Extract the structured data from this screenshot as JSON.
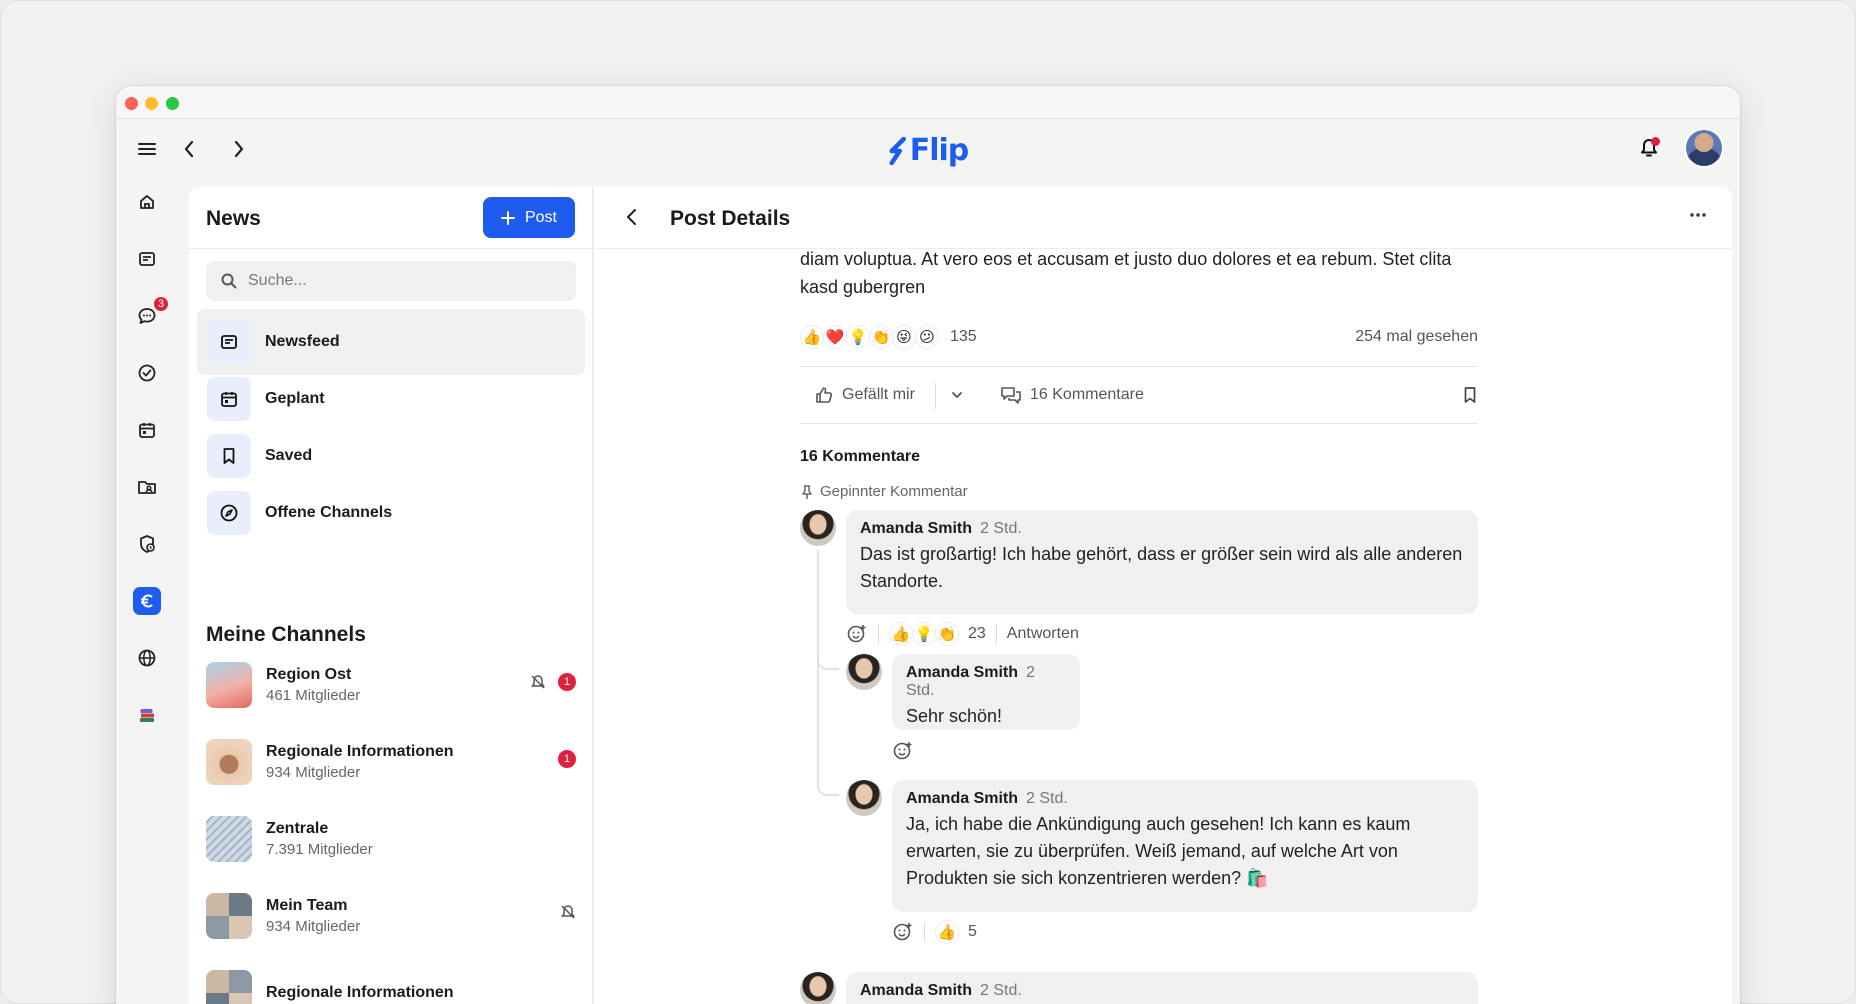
{
  "app": {
    "logo_text": "Flip",
    "brand_color": "#1e5cf0",
    "notification_dot": true
  },
  "toolbar": {
    "menu_icon": "hamburger-icon",
    "back_icon": "chevron-left-icon",
    "forward_icon": "chevron-right-icon"
  },
  "rail": {
    "items": [
      {
        "name": "home-icon"
      },
      {
        "name": "news-icon"
      },
      {
        "name": "chat-icon",
        "badge": "3"
      },
      {
        "name": "tasks-icon"
      },
      {
        "name": "calendar-icon"
      },
      {
        "name": "files-icon"
      },
      {
        "name": "shield-icon"
      },
      {
        "name": "euro-icon",
        "active": true
      },
      {
        "name": "globe-icon"
      },
      {
        "name": "books-icon"
      }
    ]
  },
  "news": {
    "title": "News",
    "post_button": "Post",
    "search_placeholder": "Suche...",
    "nav": [
      {
        "label": "Newsfeed",
        "active": true
      },
      {
        "label": "Geplant"
      },
      {
        "label": "Saved"
      },
      {
        "label": "Offene Channels"
      }
    ],
    "channels_title": "Meine Channels",
    "channels": [
      {
        "name": "Region Ost",
        "members": "461 Mitglieder",
        "muted": true,
        "badge": "1"
      },
      {
        "name": "Regionale Informationen",
        "members": "934 Mitglieder",
        "badge": "1"
      },
      {
        "name": "Zentrale",
        "members": "7.391 Mitglieder"
      },
      {
        "name": "Mein Team",
        "members": "934 Mitglieder",
        "muted": true
      },
      {
        "name": "Regionale Informationen",
        "members": ""
      }
    ]
  },
  "post": {
    "header_title": "Post Details",
    "body_text": "diam voluptua. At vero eos et accusam et justo duo dolores et ea rebum. Stet clita kasd gubergren",
    "reaction_emojis": [
      "👍",
      "❤️",
      "💡",
      "👏",
      "😜",
      "😕"
    ],
    "reaction_count": "135",
    "views": "254 mal gesehen",
    "like_label": "Gefällt mir",
    "comments_button": "16 Kommentare",
    "comments_title": "16 Kommentare",
    "pinned_label": "Gepinnter Kommentar"
  },
  "comments": [
    {
      "author": "Amanda Smith",
      "time": "2 Std.",
      "text": "Das ist großartig! Ich habe gehört, dass er größer sein wird als alle anderen Standorte.",
      "emojis": [
        "👍",
        "💡",
        "👏"
      ],
      "count": "23",
      "reply_label": "Antworten"
    },
    {
      "author": "Amanda Smith",
      "time": "2 Std.",
      "text": "Sehr schön!"
    },
    {
      "author": "Amanda Smith",
      "time": "2 Std.",
      "text": "Ja, ich habe die Ankündigung auch gesehen! Ich kann es kaum erwarten, sie zu überprüfen. Weiß jemand, auf welche Art von Produkten sie sich konzentrieren werden? 🛍️",
      "emojis": [
        "👍"
      ],
      "count": "5"
    },
    {
      "author": "Amanda Smith",
      "time": "2 Std."
    }
  ]
}
